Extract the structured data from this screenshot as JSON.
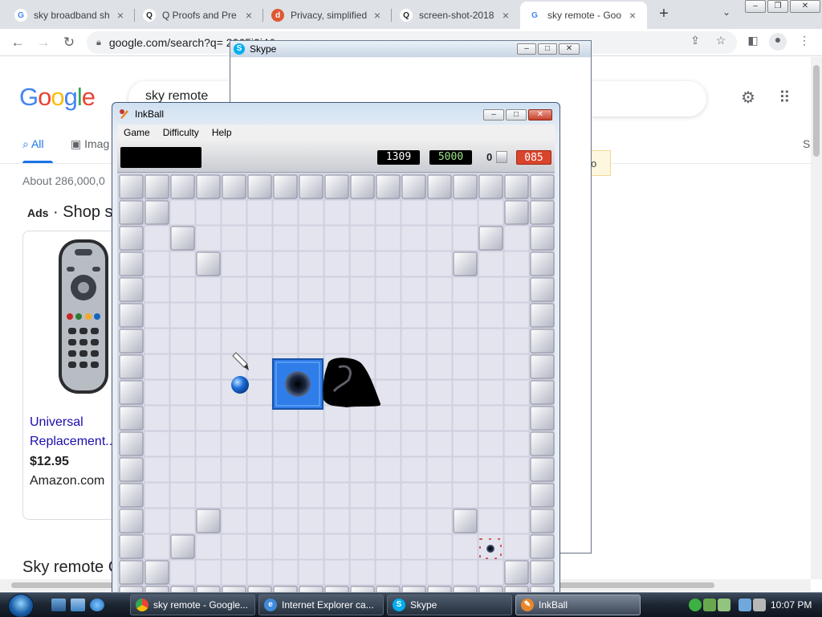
{
  "browser": {
    "tabs": [
      {
        "title": "sky broadband sh",
        "favicon": "google-icon",
        "color": "#4285f4"
      },
      {
        "title": "Q Proofs and Pre",
        "favicon": "q-icon",
        "color": "#202124"
      },
      {
        "title": "Privacy, simplified",
        "favicon": "duckduckgo-icon",
        "color": "#de5833"
      },
      {
        "title": "screen-shot-2018",
        "favicon": "q-icon",
        "color": "#202124"
      },
      {
        "title": "sky remote - Goo",
        "favicon": "google-icon",
        "color": "#4285f4"
      }
    ],
    "new_tab": "+",
    "url": "google.com/search?q=                    2065j0j4&sourc..."
  },
  "google": {
    "logo": [
      "G",
      "o",
      "o",
      "g",
      "l",
      "e"
    ],
    "search_value": "sky remote",
    "tabs": {
      "all": "All",
      "images": "Imag"
    },
    "right_tab_fragment": "S",
    "stats": "About 286,000,0",
    "ads_label": "Ads",
    "ads_title": " · Shop sk",
    "product": {
      "title": "Universal Replacement...",
      "price": "$12.95",
      "store": "Amazon.com"
    },
    "bottom_heading": "Sky remote C",
    "tooltip_fragment": "o"
  },
  "skype": {
    "title": "Skype"
  },
  "inkball": {
    "title": "InkBall",
    "menu": {
      "game": "Game",
      "difficulty": "Difficulty",
      "help": "Help"
    },
    "scores": {
      "score": "1309",
      "time": "5000",
      "count": "0",
      "remaining": "085"
    },
    "colors": {
      "hole": "#2f7de9",
      "ball": "#1c6cd8",
      "tile": "#e3e4ee",
      "wall": "#c7c9d6"
    }
  },
  "taskbar": {
    "tasks": [
      {
        "label": "sky remote - Google...",
        "icon": "chrome-icon",
        "color": "#4285f4"
      },
      {
        "label": "Internet Explorer ca...",
        "icon": "ie-icon",
        "color": "#3f8ad9"
      },
      {
        "label": "Skype",
        "icon": "skype-icon",
        "color": "#00aff0"
      },
      {
        "label": "InkBall",
        "icon": "inkball-icon",
        "color": "#e8872a"
      }
    ],
    "clock": "10:07 PM"
  }
}
